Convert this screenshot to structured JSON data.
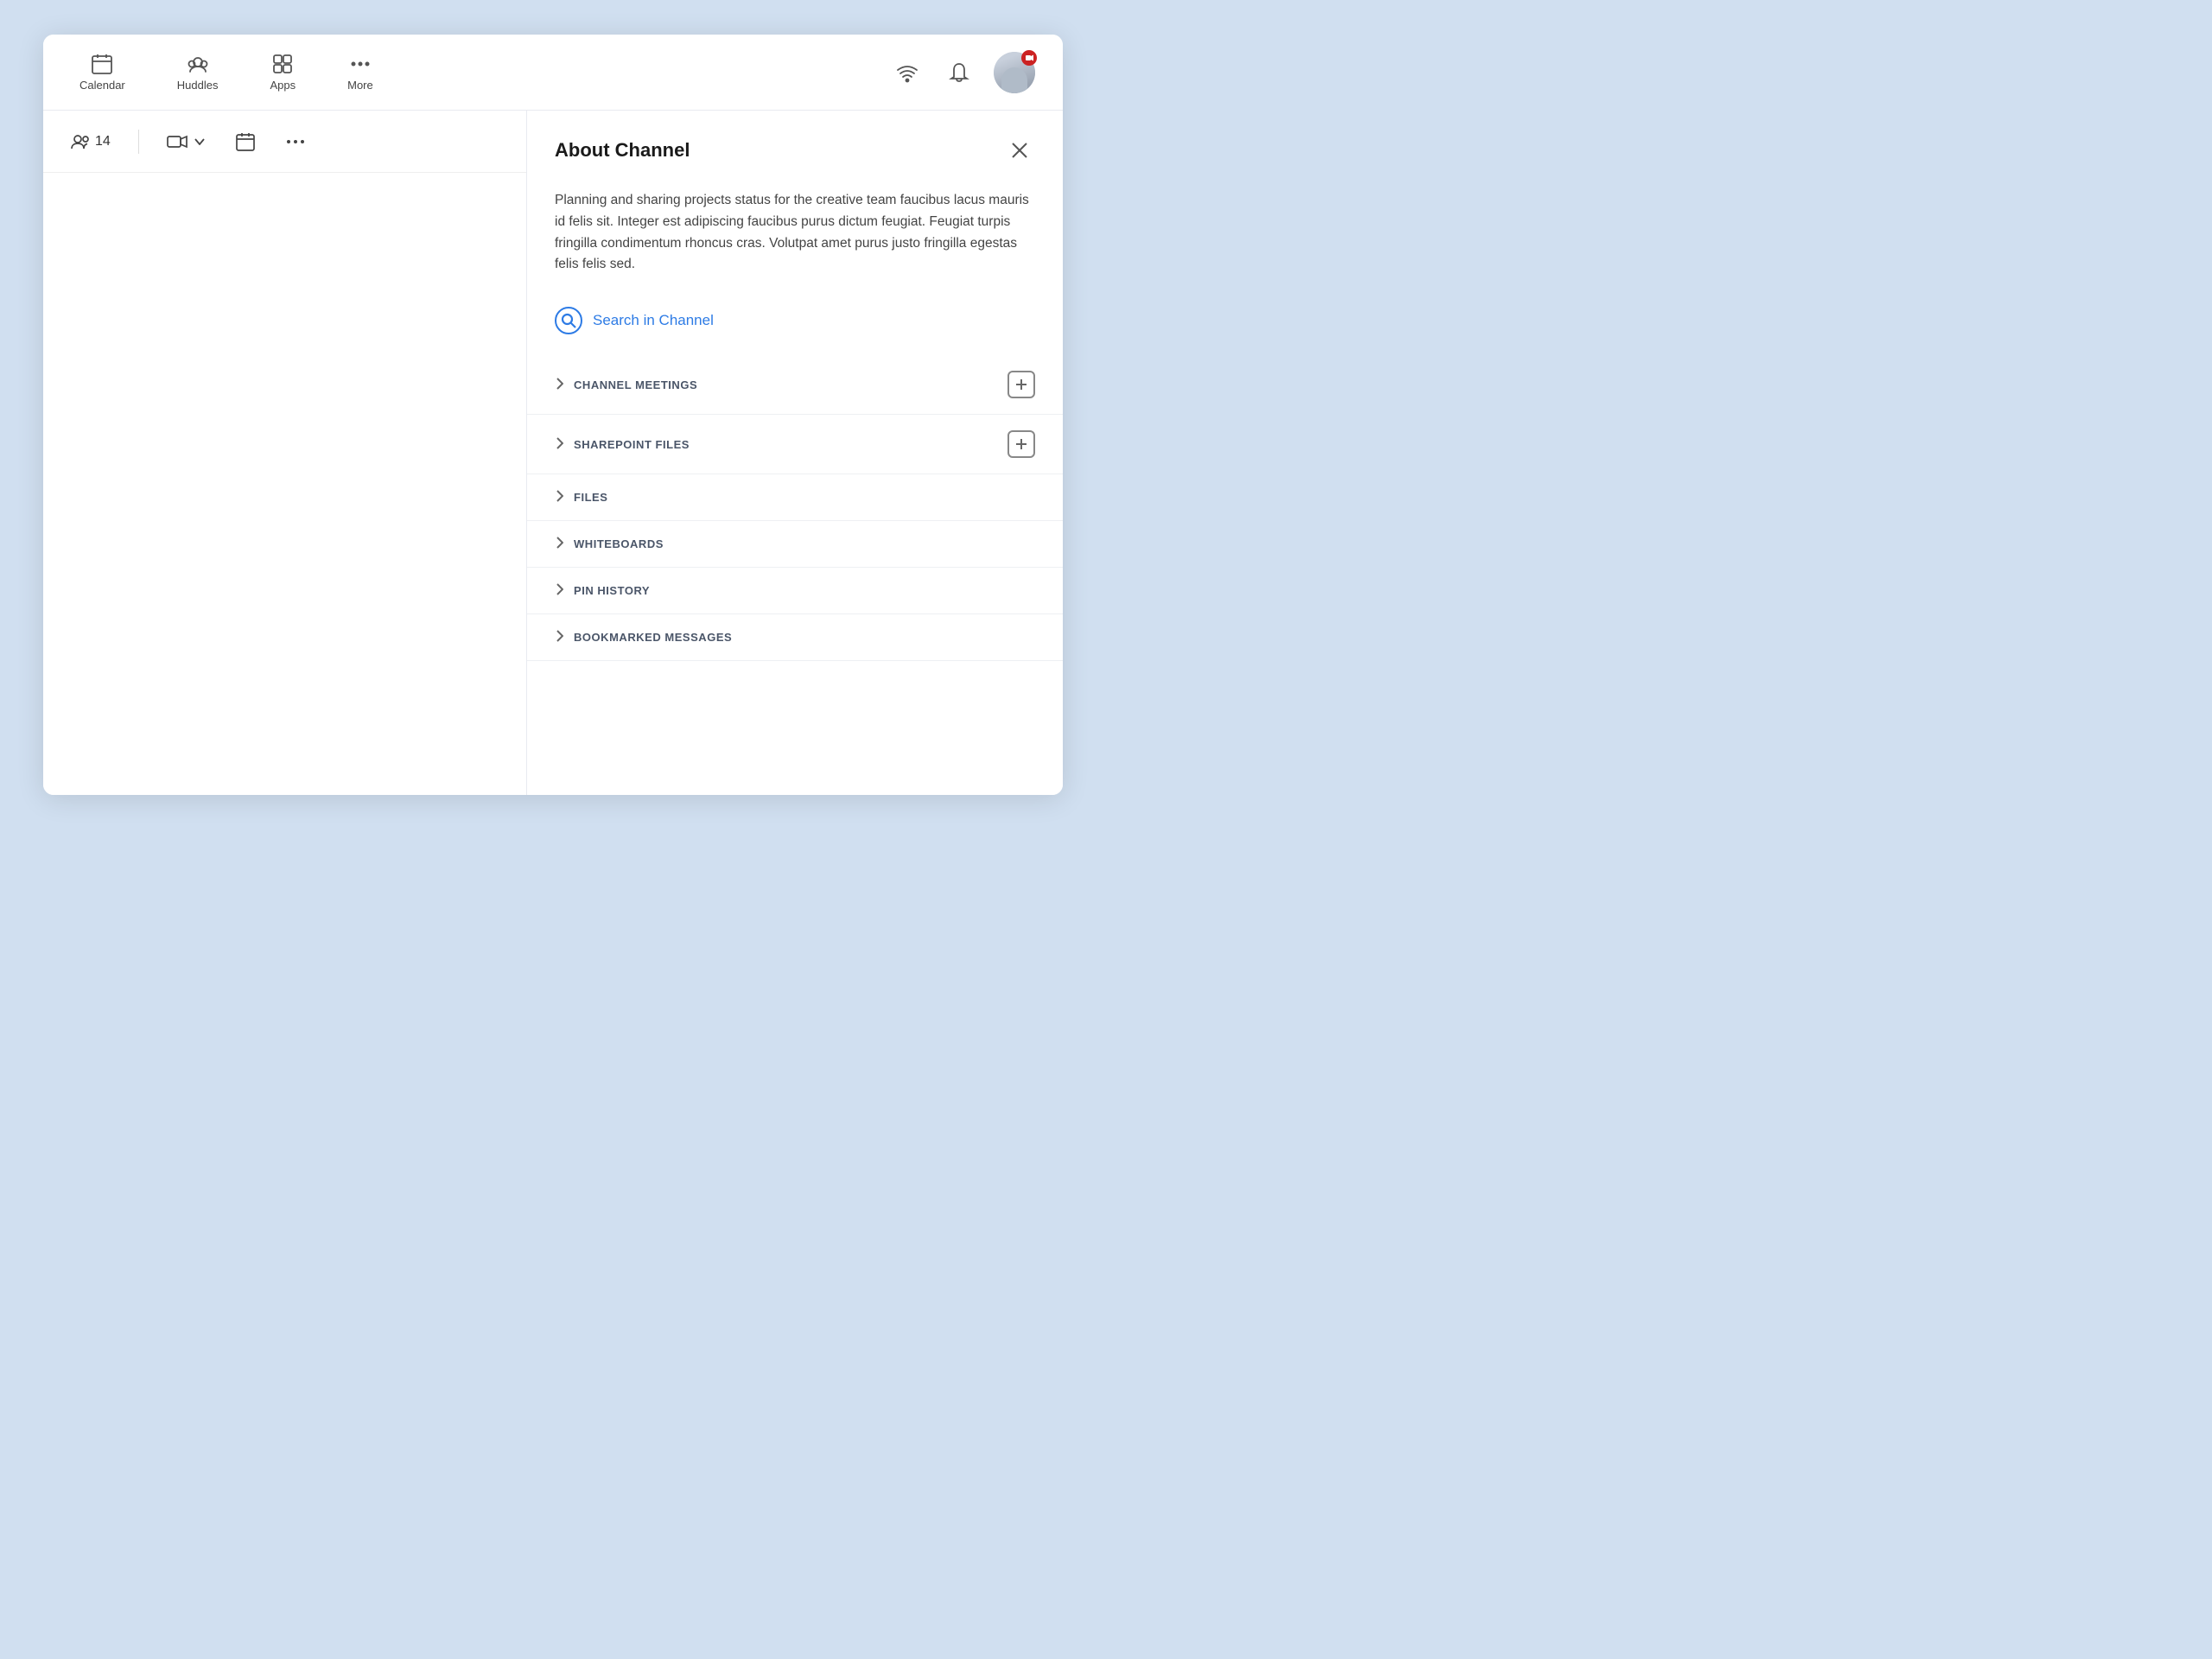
{
  "nav": {
    "items": [
      {
        "id": "calendar",
        "label": "Calendar"
      },
      {
        "id": "huddles",
        "label": "Huddles"
      },
      {
        "id": "apps",
        "label": "Apps"
      },
      {
        "id": "more",
        "label": "More"
      }
    ]
  },
  "toolbar": {
    "member_count": "14",
    "member_label": "14"
  },
  "about": {
    "title": "About Channel",
    "description": "Planning and sharing projects status for the creative team faucibus lacus mauris id felis sit. Integer est adipiscing faucibus purus dictum feugiat. Feugiat turpis fringilla condimentum rhoncus cras. Volutpat amet purus justo fringilla egestas felis felis sed.",
    "search_label": "Search in Channel",
    "sections": [
      {
        "id": "channel-meetings",
        "label": "CHANNEL MEETINGS",
        "has_plus": true
      },
      {
        "id": "sharepoint-files",
        "label": "SHAREPOINT FILES",
        "has_plus": true
      },
      {
        "id": "files",
        "label": "FILES",
        "has_plus": false
      },
      {
        "id": "whiteboards",
        "label": "WHITEBOARDS",
        "has_plus": false
      },
      {
        "id": "pin-history",
        "label": "PIN HISTORY",
        "has_plus": false
      },
      {
        "id": "bookmarked-messages",
        "label": "BOOKMARKED MESSAGES",
        "has_plus": false
      }
    ]
  }
}
